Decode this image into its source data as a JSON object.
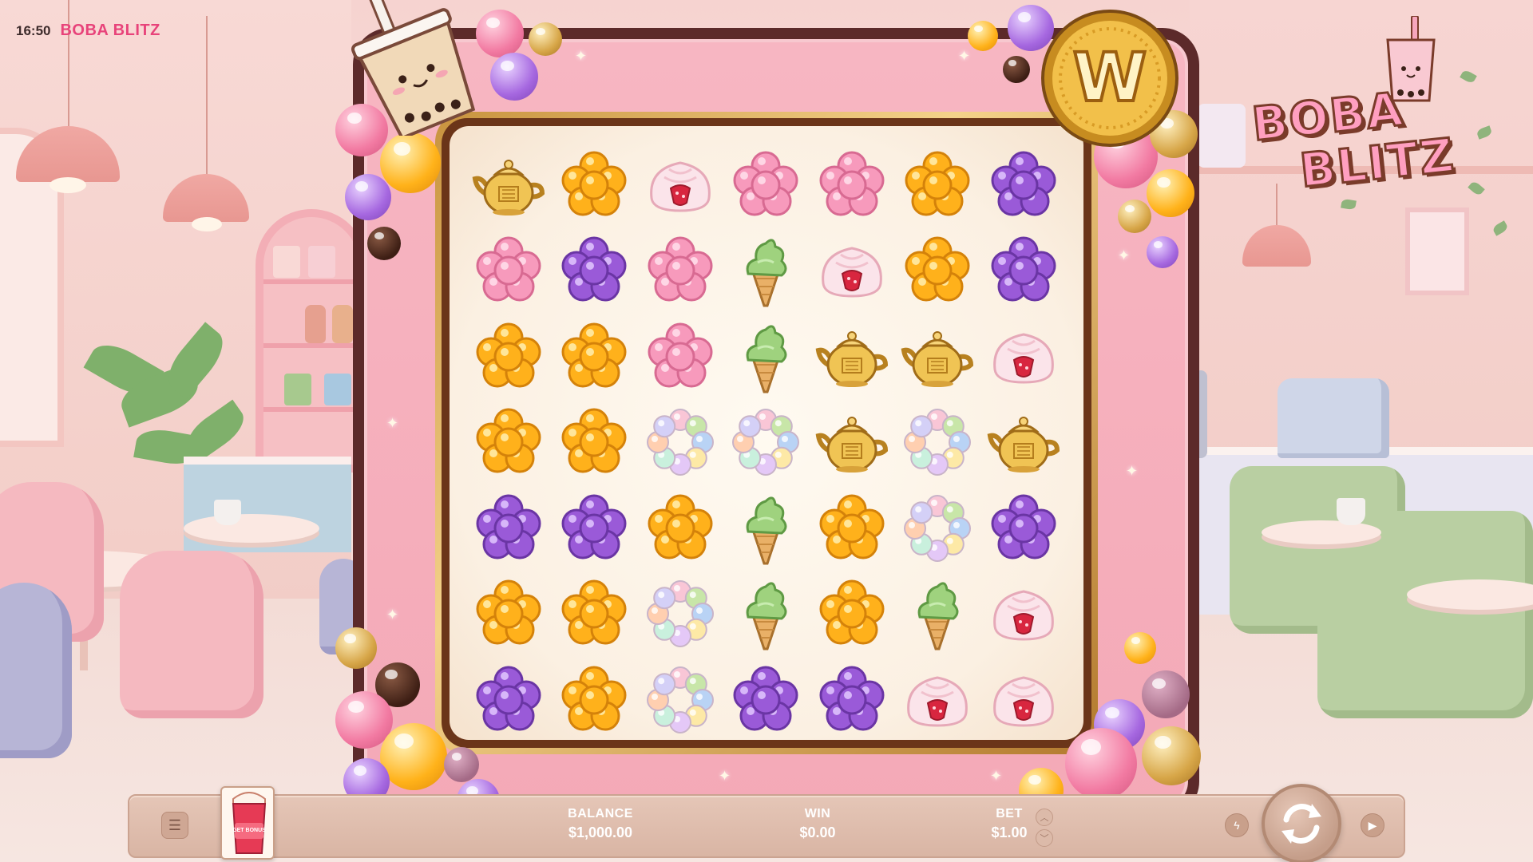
{
  "status_bar": {
    "time": "16:50",
    "game_title": "BOBA BLITZ"
  },
  "logo": {
    "line1": "BOBA",
    "line2": "BLITZ"
  },
  "coin": {
    "letter": "W"
  },
  "symbols_legend": {
    "teapot": "gold teapot",
    "orange": "orange boba cluster",
    "pink": "pink boba cluster",
    "purple": "purple boba cluster",
    "bun": "strawberry bun",
    "icecream": "matcha ice cream",
    "rainbow": "rainbow boba ring"
  },
  "grid": [
    [
      "teapot",
      "orange",
      "bun",
      "pink",
      "pink",
      "orange",
      "purple"
    ],
    [
      "pink",
      "purple",
      "pink",
      "icecream",
      "bun",
      "orange",
      "purple"
    ],
    [
      "orange",
      "orange",
      "pink",
      "icecream",
      "teapot",
      "teapot",
      "bun"
    ],
    [
      "orange",
      "orange",
      "rainbow",
      "rainbow",
      "teapot",
      "rainbow",
      "teapot"
    ],
    [
      "purple",
      "purple",
      "orange",
      "icecream",
      "orange",
      "rainbow",
      "purple"
    ],
    [
      "orange",
      "orange",
      "rainbow",
      "icecream",
      "orange",
      "icecream",
      "bun"
    ],
    [
      "purple",
      "orange",
      "rainbow",
      "purple",
      "purple",
      "bun",
      "bun"
    ]
  ],
  "controls": {
    "menu_icon": "hamburger-menu-icon",
    "bonus_label": "GET BONUS",
    "balance_label": "BALANCE",
    "balance_value": "$1,000.00",
    "win_label": "WIN",
    "win_value": "$0.00",
    "bet_label": "BET",
    "bet_value": "$1.00",
    "turbo_icon": "lightning-icon",
    "spin_icon": "spin-arrows-icon",
    "autoplay_icon": "play-icon"
  },
  "colors": {
    "frame_pink": "#f4a9b7",
    "frame_outline": "#5c2a2a",
    "title_pink": "#e8437a",
    "board_cream": "#fbf0e2",
    "bar": "#d9b5a4"
  }
}
